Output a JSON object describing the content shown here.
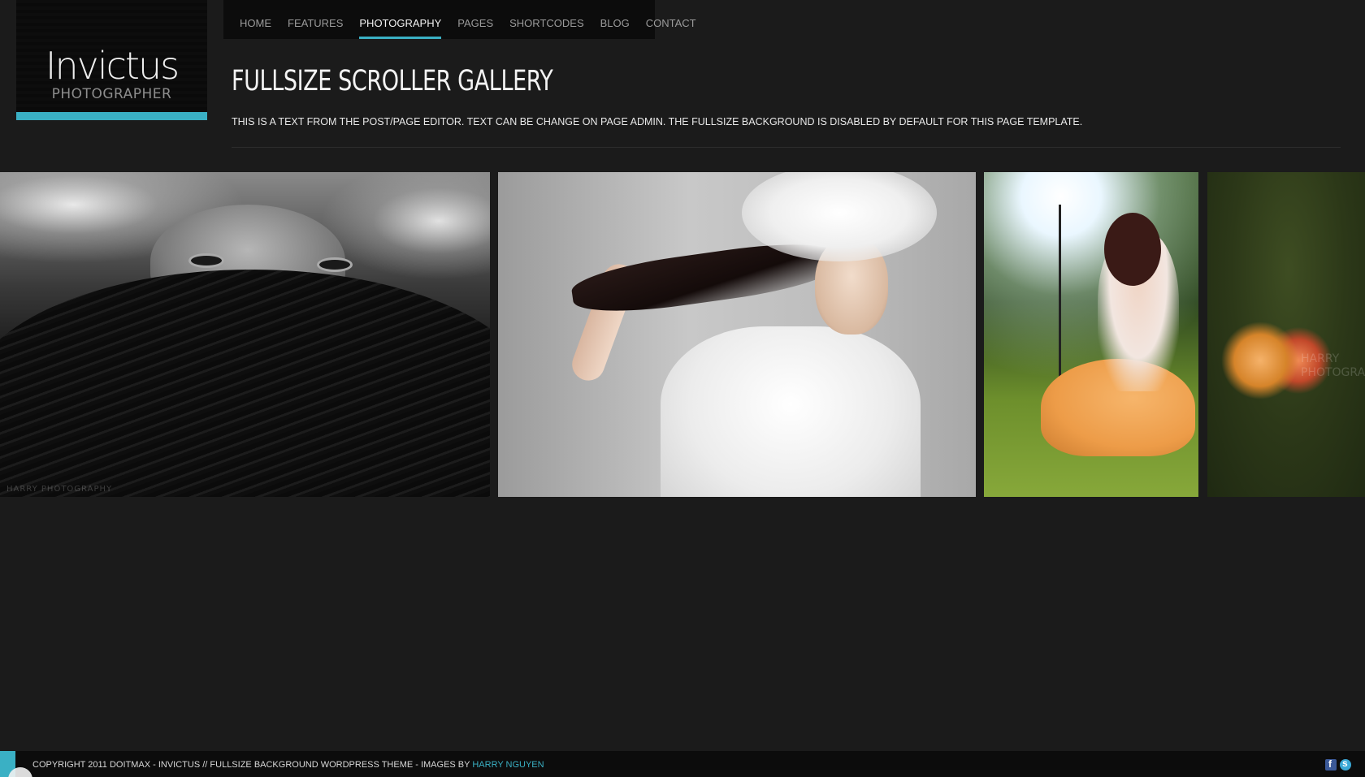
{
  "logo": {
    "name": "Invictus",
    "subtitle": "PHOTOGRAPHER"
  },
  "nav": {
    "items": [
      {
        "label": "HOME"
      },
      {
        "label": "FEATURES"
      },
      {
        "label": "PHOTOGRAPHY",
        "active": true
      },
      {
        "label": "PAGES"
      },
      {
        "label": "SHORTCODES"
      },
      {
        "label": "BLOG"
      },
      {
        "label": "CONTACT"
      }
    ]
  },
  "page": {
    "title": "FULLSIZE SCROLLER GALLERY",
    "description": "THIS IS A TEXT FROM THE POST/PAGE EDITOR. TEXT CAN BE CHANGE ON PAGE ADMIN. THE FULLSIZE BACKGROUND IS DISABLED BY DEFAULT FOR THIS PAGE TEMPLATE."
  },
  "gallery": {
    "photos": [
      {
        "watermark": "HARRY PHOTOGRAPHY"
      },
      {
        "watermark": ""
      },
      {
        "watermark": ""
      },
      {
        "watermark": "HARRY PHOTOGRA"
      }
    ]
  },
  "footer": {
    "copyright": "COPYRIGHT 2011 DOITMAX - INVICTUS // FULLSIZE BACKGROUND WORDPRESS THEME - IMAGES BY",
    "author_link": "HARRY NGUYEN",
    "social": [
      "facebook-icon",
      "skype-icon"
    ]
  },
  "colors": {
    "accent": "#3ab0c4",
    "background": "#1b1b1b",
    "panel": "#0c0c0c"
  }
}
